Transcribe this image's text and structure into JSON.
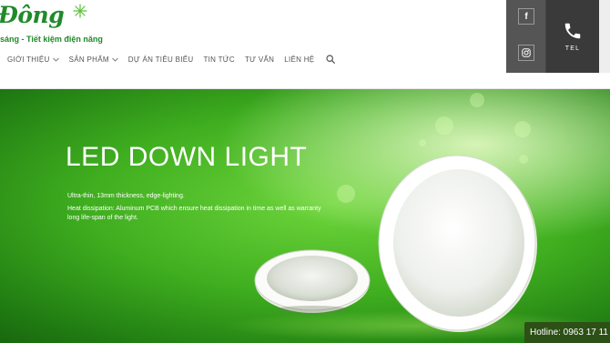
{
  "brand": {
    "name": "Đông",
    "tagline": "sáng - Tiết kiệm điện năng"
  },
  "nav": {
    "items": [
      {
        "label": "GIỚI THIỆU",
        "has_dropdown": true
      },
      {
        "label": "SẢN PHẨM",
        "has_dropdown": true
      },
      {
        "label": "DỰ ÁN TIÊU BIỂU",
        "has_dropdown": false
      },
      {
        "label": "TIN TỨC",
        "has_dropdown": false
      },
      {
        "label": "TƯ VẤN",
        "has_dropdown": false
      },
      {
        "label": "LIÊN HỆ",
        "has_dropdown": false
      }
    ],
    "search_icon": "search-icon"
  },
  "social": {
    "facebook_glyph": "f",
    "instagram_icon": "instagram-icon"
  },
  "contact": {
    "tel_label": "TEL",
    "phone_icon": "phone-icon"
  },
  "banner": {
    "title": "LED DOWN LIGHT",
    "desc_1": "Ultra-thin, 13mm thickness, edge-lighting.",
    "desc_2": "Heat dissipation: Aluminum PCB which ensure heat dissipation in time as well as warranty long life-span of the light."
  },
  "hotline": {
    "text": "Hotline: 0963 17 11"
  },
  "colors": {
    "brand_green": "#1f8a2a",
    "social_bg": "#555555",
    "tel_bg": "#3a3a3a",
    "hotline_bg": "#2c5016"
  }
}
